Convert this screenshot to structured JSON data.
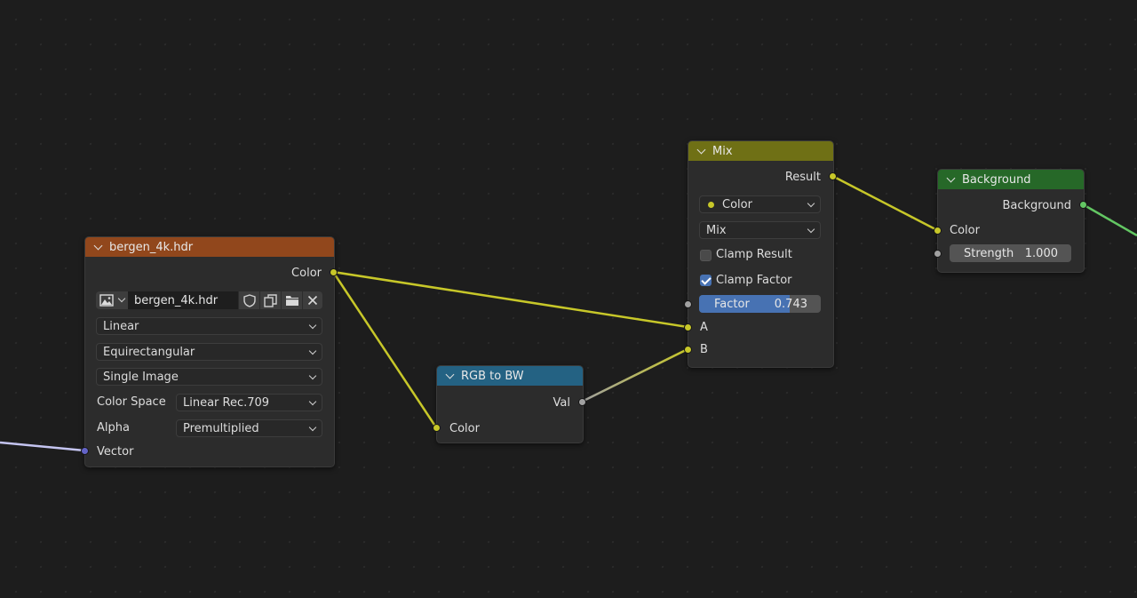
{
  "colors": {
    "background": "#1d1d1d",
    "image_header": "#91471c",
    "convertor_header": "#246283",
    "mix_header": "#6f7015",
    "output_header": "#266828",
    "socket_color": "#c7c729",
    "socket_float": "#a1a1a1",
    "socket_vector": "#6363c7",
    "socket_shader": "#63c763",
    "accent": "#4772b3"
  },
  "image_node": {
    "title": "bergen_4k.hdr",
    "output_color": "Color",
    "image_name": "bergen_4k.hdr",
    "interpolation": "Linear",
    "projection": "Equirectangular",
    "source": "Single Image",
    "color_space_label": "Color Space",
    "color_space_value": "Linear Rec.709",
    "alpha_label": "Alpha",
    "alpha_value": "Premultiplied",
    "input_vector": "Vector"
  },
  "rgb_to_bw_node": {
    "title": "RGB to BW",
    "output_val": "Val",
    "input_color": "Color"
  },
  "mix_node": {
    "title": "Mix",
    "output_result": "Result",
    "data_type": "Color",
    "blend_mode": "Mix",
    "clamp_result_label": "Clamp Result",
    "clamp_result_checked": false,
    "clamp_factor_label": "Clamp Factor",
    "clamp_factor_checked": true,
    "factor_label": "Factor",
    "factor_value": "0.743",
    "factor_fraction": 0.743,
    "input_a": "A",
    "input_b": "B"
  },
  "background_node": {
    "title": "Background",
    "output_background": "Background",
    "input_color": "Color",
    "strength_label": "Strength",
    "strength_value": "1.000"
  }
}
